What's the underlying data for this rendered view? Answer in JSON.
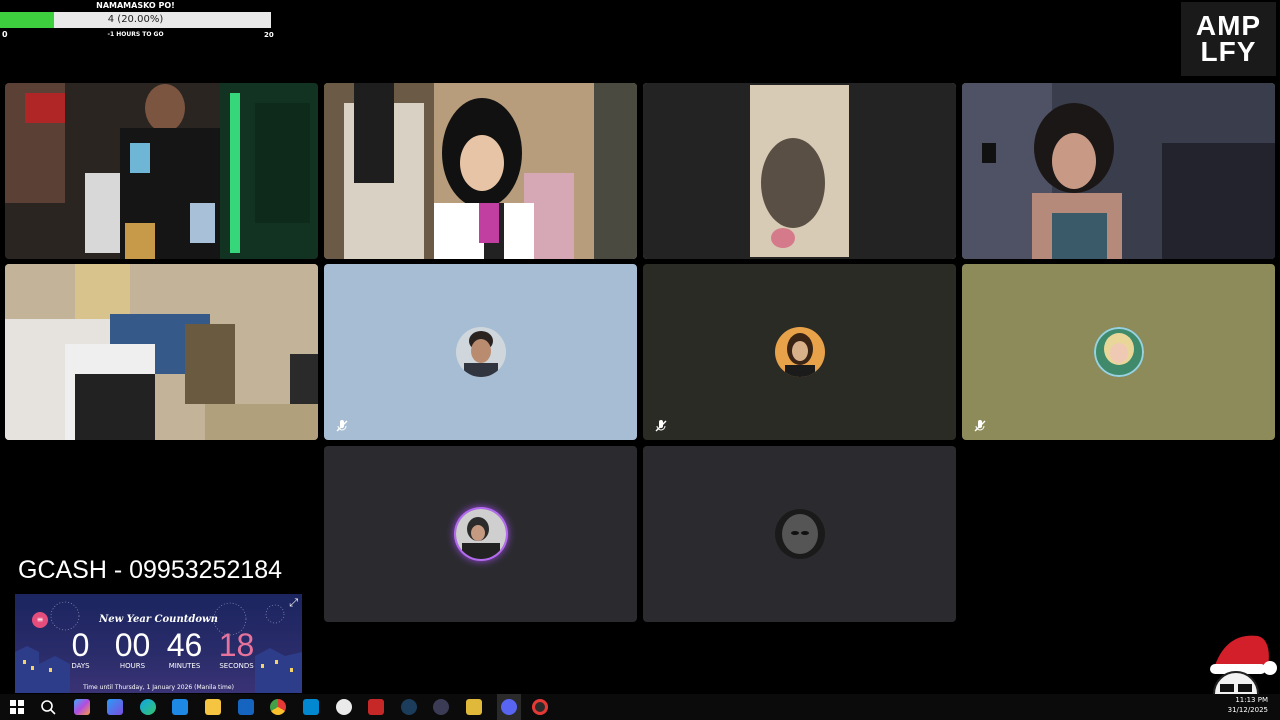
{
  "goal": {
    "title": "NAMAMASKO PO!",
    "progress_label": "4 (20.00%)",
    "progress_fraction": 0.2,
    "min": "0",
    "max": "20",
    "subtitle": "-1 HOURS TO GO"
  },
  "logo": {
    "line1": "AMP",
    "line2": "LFY"
  },
  "tiles": {
    "p1": {
      "kind": "video"
    },
    "p2": {
      "kind": "video"
    },
    "p3": {
      "kind": "video",
      "speaking": true
    },
    "p4": {
      "kind": "video",
      "speaking": true
    },
    "p5": {
      "kind": "video"
    },
    "p6": {
      "kind": "avatar",
      "bg": "#a6bdd3",
      "muted": true
    },
    "p7": {
      "kind": "avatar",
      "bg": "#2a2b25",
      "muted": true
    },
    "p8": {
      "kind": "avatar",
      "bg": "#8d8b5a",
      "muted": true
    },
    "p9": {
      "kind": "avatar",
      "bg": "#2b2b2f",
      "muted": false
    },
    "p10": {
      "kind": "avatar",
      "bg": "#2b2b2f",
      "muted": false
    }
  },
  "overlay": {
    "gcash": "GCASH - 09953252184"
  },
  "countdown": {
    "title": "New Year Countdown",
    "days": "0",
    "hours": "00",
    "minutes": "46",
    "seconds": "18",
    "days_label": "DAYS",
    "hours_label": "HOURS",
    "minutes_label": "MINUTES",
    "seconds_label": "SECONDS",
    "footer": "Time until Thursday, 1 January 2026 (Manila time)"
  },
  "taskbar": {
    "time": "11:13 PM",
    "date": "31/12/2025"
  },
  "colors": {
    "accent_green": "#3ecf3e",
    "speaking_border": "#7fd17f",
    "countdown_pink": "#e6739c"
  }
}
